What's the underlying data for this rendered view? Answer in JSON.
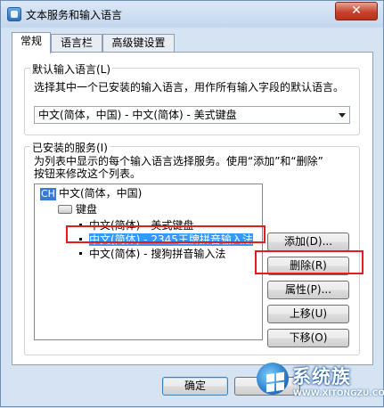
{
  "window": {
    "title": "文本服务和输入语言",
    "close_glyph": "✕"
  },
  "tabs": [
    {
      "label": "常规",
      "active": true
    },
    {
      "label": "语言栏",
      "active": false
    },
    {
      "label": "高级键设置",
      "active": false
    }
  ],
  "default_language": {
    "group_label": "默认输入语言(L)",
    "description": "选择其中一个已安装的输入语言，用作所有输入字段的默认语言。",
    "selected": "中文(简体，中国) - 中文(简体) - 美式键盘"
  },
  "installed_services": {
    "group_label": "已安装的服务(I)",
    "description_line1": "为列表中显示的每个输入语言选择服务。使用“添加”和“删除”",
    "description_line2": "按钮来修改这个列表。",
    "tree": {
      "language_badge": "CH",
      "language": "中文(简体，中国)",
      "category": "键盘",
      "items": [
        {
          "label": "中文(简体) - 美式键盘",
          "selected": false
        },
        {
          "label": "中文(简体) - 2345王牌拼音输入法",
          "selected": true
        },
        {
          "label": "中文(简体) - 搜狗拼音输入法",
          "selected": false
        }
      ]
    },
    "buttons": {
      "add": "添加(D)...",
      "remove": "删除(R)",
      "properties": "属性(P)...",
      "move_up": "上移(U)",
      "move_down": "下移(O)"
    }
  },
  "footer": {
    "ok": "确定",
    "cancel": "取"
  },
  "watermark": {
    "brand": "系统族",
    "url": "WWW.XITONGZU.COM"
  },
  "colors": {
    "selection": "#3399ff",
    "highlight_box": "#e11d1d",
    "close_button": "#c7432c"
  }
}
